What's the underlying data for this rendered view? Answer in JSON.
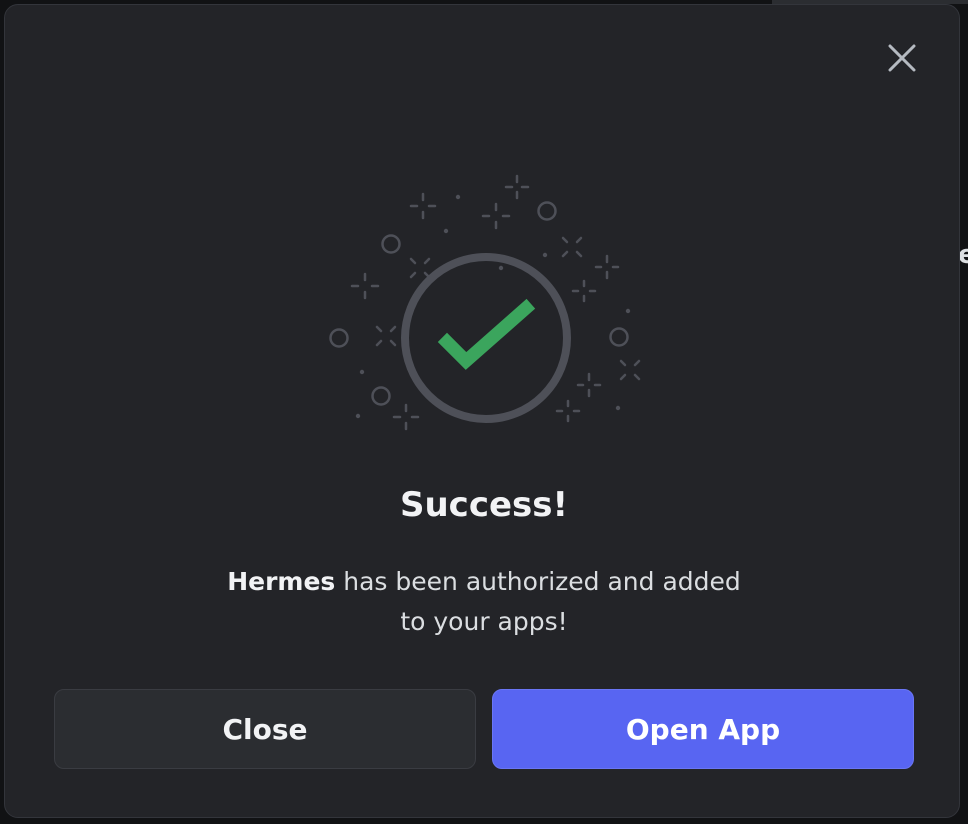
{
  "modal": {
    "title": "Success!",
    "message_app_name": "Hermes",
    "message_rest_line1": " has been authorized and added",
    "message_line2": "to your apps!",
    "close_icon": "close-icon",
    "hero_icon": "checkmark-icon"
  },
  "buttons": {
    "close_label": "Close",
    "open_label": "Open App"
  },
  "colors": {
    "modal_bg": "#232428",
    "accent": "#5865f2",
    "success": "#3ba55d"
  }
}
